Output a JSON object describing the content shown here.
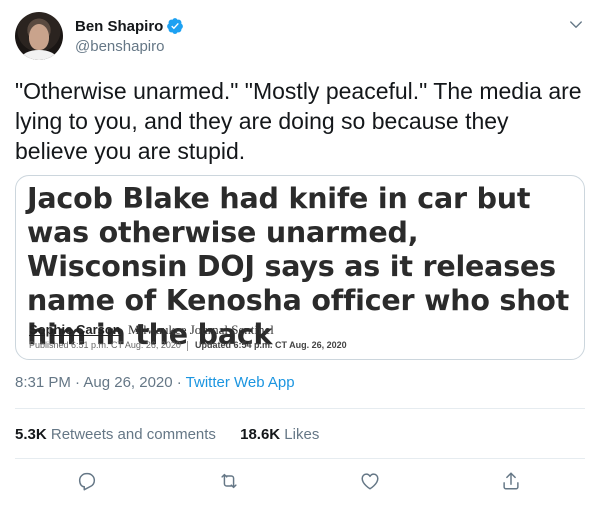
{
  "tweet": {
    "author_name": "Ben Shapiro",
    "handle": "@benshapiro",
    "text": "\"Otherwise unarmed.\" \"Mostly peaceful.\" The media are lying to you, and they are doing so because they believe you are stupid.",
    "timestamp": "8:31 PM · Aug 26, 2020 · ",
    "source": "Twitter Web App"
  },
  "media": {
    "headline": "Jacob Blake had knife in car but was otherwise unarmed, Wisconsin DOJ says as it releases name of Kenosha officer who shot him in the back",
    "byline_author": "Sophie Carson",
    "byline_publication": "Milwaukee Journal Sentinel",
    "published": "Published 6:51 p.m. CT Aug. 26, 2020",
    "updated": "Updated 6:54 p.m. CT Aug. 26, 2020"
  },
  "stats": {
    "retweets_count": "5.3K",
    "retweets_label": " Retweets and comments",
    "likes_count": "18.6K",
    "likes_label": " Likes"
  },
  "icons": {
    "verified": "verified-badge-icon",
    "caret": "chevron-down-icon",
    "reply": "reply-icon",
    "retweet": "retweet-icon",
    "like": "heart-icon",
    "share": "share-icon"
  },
  "colors": {
    "accent": "#1da1f2",
    "link": "#1b95e0",
    "secondary_text": "#657786"
  }
}
